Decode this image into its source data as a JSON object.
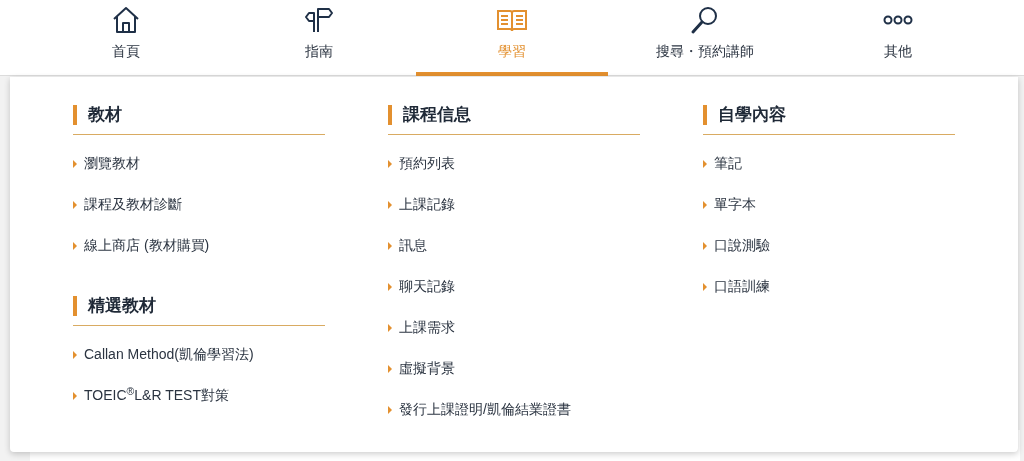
{
  "nav": [
    {
      "label": "首頁",
      "selected": false
    },
    {
      "label": "指南",
      "selected": false
    },
    {
      "label": "學習",
      "selected": true
    },
    {
      "label": "搜尋・預約講師",
      "selected": false
    },
    {
      "label": "其他",
      "selected": false
    }
  ],
  "menu": {
    "columns": [
      {
        "sections": [
          {
            "title": "教材",
            "items": [
              "瀏覽教材",
              "課程及教材診斷",
              "線上商店 (教材購買)"
            ]
          },
          {
            "title": "精選教材",
            "items": [
              "Callan Method(凱倫學習法)",
              "TOEIC$^{®}$L&R TEST對策"
            ]
          }
        ]
      },
      {
        "sections": [
          {
            "title": "課程信息",
            "items": [
              "預約列表",
              "上課記錄",
              "訊息",
              "聊天記錄",
              "上課需求",
              "虛擬背景",
              "發行上課證明/凱倫結業證書"
            ]
          }
        ]
      },
      {
        "sections": [
          {
            "title": "自學內容",
            "items": [
              "筆記",
              "單字本",
              "口說測驗",
              "口語訓練"
            ]
          }
        ]
      }
    ]
  }
}
